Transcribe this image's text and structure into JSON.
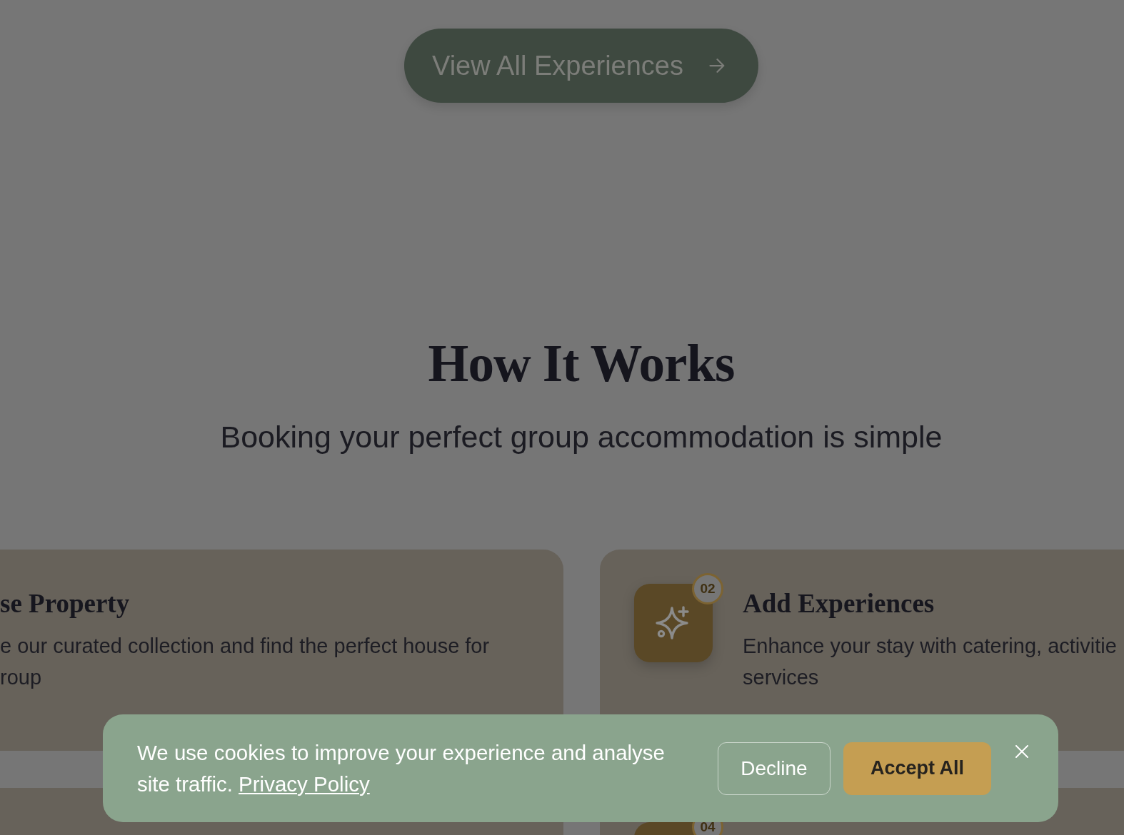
{
  "cta_button": {
    "label": "View All Experiences"
  },
  "how_it_works": {
    "title": "How It Works",
    "subtitle": "Booking your perfect group accommodation is simple",
    "steps": [
      {
        "kind": "cut",
        "title": "se Property",
        "description": "e our curated collection and find the perfect house for roup"
      },
      {
        "kind": "full",
        "number": "02",
        "title": "Add Experiences",
        "description": "Enhance your stay with catering, activitie services"
      },
      {
        "kind": "cut"
      },
      {
        "kind": "full",
        "number": "04"
      }
    ]
  },
  "cookie_banner": {
    "text": "We use cookies to improve your experience and analyse site traffic.",
    "link": "Privacy Policy",
    "buttons": [
      {
        "label": "Decline",
        "kind": "secondary"
      },
      {
        "label": "Accept All",
        "kind": "primary"
      }
    ]
  }
}
